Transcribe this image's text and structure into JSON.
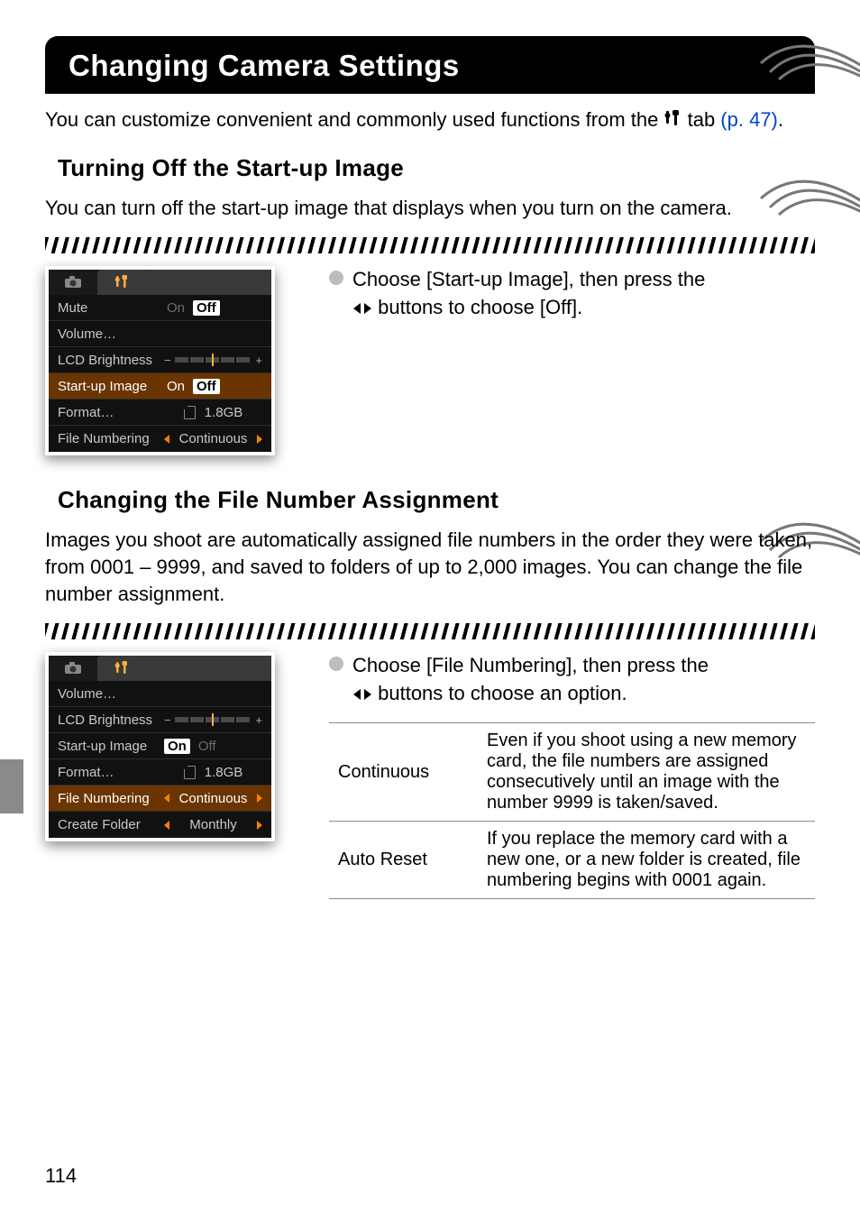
{
  "page_number": "114",
  "main_title": "Changing Camera Settings",
  "intro_before": "You can customize convenient and commonly used functions from the ",
  "intro_after": " tab ",
  "intro_link": "(p. 47)",
  "intro_end": ".",
  "sec1": {
    "title": "Turning Off the Start-up Image",
    "intro": "You can turn off the start-up image that displays when you turn on the camera.",
    "bullet_line1": "Choose [Start-up Image], then press the ",
    "bullet_line2": " buttons to choose [Off].",
    "lcd": {
      "rows": [
        {
          "label": "Mute",
          "on": "On",
          "off": "Off",
          "hl": false,
          "type": "onoff",
          "sel": "off",
          "dim_on": true
        },
        {
          "label": "Volume…",
          "type": "plain"
        },
        {
          "label": "LCD Brightness",
          "type": "bar"
        },
        {
          "label": "Start-up Image",
          "on": "On",
          "off": "Off",
          "hl": true,
          "type": "onoff",
          "sel": "off"
        },
        {
          "label": "Format…",
          "type": "format",
          "size": "1.8GB"
        },
        {
          "label": "File Numbering",
          "type": "nav",
          "value": "Continuous"
        }
      ]
    }
  },
  "sec2": {
    "title": "Changing the File Number Assignment",
    "intro": "Images you shoot are automatically assigned file numbers in the order they were taken, from 0001 – 9999, and saved to folders of up to 2,000 images. You can change the file number assignment.",
    "bullet_line1": "Choose [File Numbering], then press the ",
    "bullet_line2": " buttons to choose an option.",
    "options": [
      {
        "name": "Continuous",
        "desc": "Even if you shoot using a new memory card, the file numbers are assigned consecutively until an image with the number 9999 is taken/saved."
      },
      {
        "name": "Auto Reset",
        "desc": "If you replace the memory card with a new one, or a new folder is created, file numbering begins with 0001 again."
      }
    ],
    "lcd": {
      "rows": [
        {
          "label": "Volume…",
          "type": "plain"
        },
        {
          "label": "LCD Brightness",
          "type": "bar"
        },
        {
          "label": "Start-up Image",
          "on": "On",
          "off": "Off",
          "type": "onoff",
          "sel": "on",
          "dim_off": true
        },
        {
          "label": "Format…",
          "type": "format",
          "size": "1.8GB"
        },
        {
          "label": "File Numbering",
          "type": "nav",
          "value": "Continuous",
          "hl": true
        },
        {
          "label": "Create Folder",
          "type": "nav",
          "value": "Monthly"
        }
      ]
    }
  }
}
